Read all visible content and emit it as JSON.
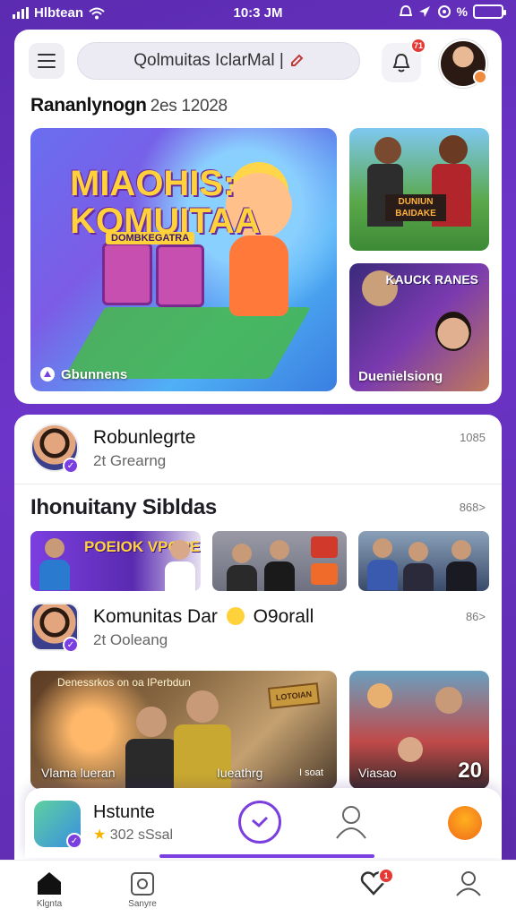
{
  "status_bar": {
    "carrier": "Hlbtean",
    "time": "10:3 JM",
    "battery_text": "%"
  },
  "header": {
    "search_text": "Qolmuitas IclarMal |",
    "notification_count": "71"
  },
  "featured": {
    "title": "Rananlynogn",
    "subtitle": "2es 12028",
    "hero": {
      "title_line1": "MIAOHIS:",
      "title_line2": "KOMUITAA",
      "tagline": "DOMBKEGATRA",
      "label": "Gbunnens"
    },
    "side_top": {
      "banner": "DUNIUN BAIDAKE"
    },
    "side_bottom": {
      "title": "KAUCK RANES",
      "label": "Duenielsiong"
    }
  },
  "feed": {
    "post1": {
      "name": "Robunlegrte",
      "sub": "2t Grearng",
      "meta": "1085"
    },
    "section_title": "Ihonuitany Sibldas",
    "section_more": "868>",
    "strip1_text": "POEIOK VPOPE",
    "post2": {
      "name": "Komunitas Dar",
      "name_suffix": "O9orall",
      "sub": "2t Ooleang",
      "meta": "86>"
    },
    "photo_left": {
      "caption": "Denessrkos on oa IPerbdun",
      "sign": "LOTOIAN",
      "label_a": "Vlama lueran",
      "label_b": "Iueathrg",
      "label_c": "I soat"
    },
    "photo_right": {
      "label": "Viasao",
      "number": "20"
    }
  },
  "mini_player": {
    "title": "Hstunte",
    "sub": "302 sSsal"
  },
  "bottom_nav": {
    "home": "Klgnta",
    "explore": "Sanyre",
    "notif_count": "1"
  },
  "colors": {
    "accent": "#7b3fe0",
    "background": "#5b2bb0"
  }
}
